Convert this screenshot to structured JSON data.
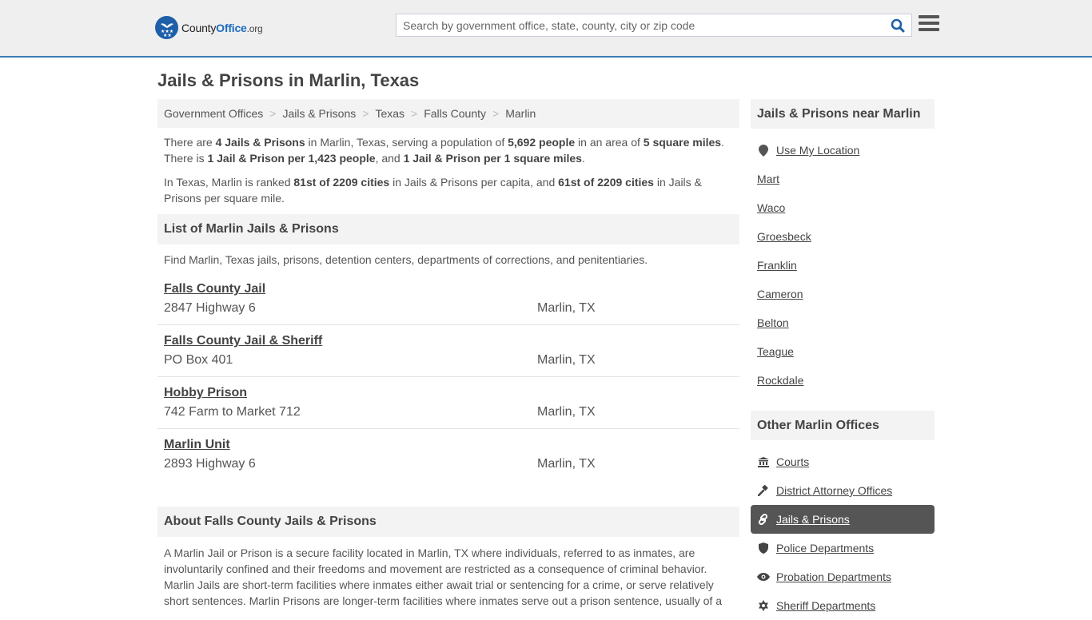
{
  "header": {
    "logo_name": "County",
    "logo_accent": "Office",
    "logo_tld": ".org",
    "search_placeholder": "Search by government office, state, county, city or zip code",
    "search_value": ""
  },
  "page_title": "Jails & Prisons in Marlin, Texas",
  "breadcrumb": [
    {
      "label": "Government Offices"
    },
    {
      "label": "Jails & Prisons"
    },
    {
      "label": "Texas"
    },
    {
      "label": "Falls County"
    },
    {
      "label": "Marlin"
    }
  ],
  "intro": {
    "p1": {
      "t1": "There are ",
      "b1": "4 Jails & Prisons",
      "t2": " in Marlin, Texas, serving a population of ",
      "b2": "5,692 people",
      "t3": " in an area of ",
      "b3": "5 square miles",
      "t4": ". There is ",
      "b4": "1 Jail & Prison per 1,423 people",
      "t5": ", and ",
      "b5": "1 Jail & Prison per 1 square miles",
      "t6": "."
    },
    "p2": {
      "t1": "In Texas, Marlin is ranked ",
      "b1": "81st of 2209 cities",
      "t2": " in Jails & Prisons per capita, and ",
      "b2": "61st of 2209 cities",
      "t3": " in Jails & Prisons per square mile."
    }
  },
  "list_section": {
    "title": "List of Marlin Jails & Prisons",
    "description": "Find Marlin, Texas jails, prisons, detention centers, departments of corrections, and penitentiaries.",
    "listings": [
      {
        "name": "Falls County Jail",
        "address": "2847 Highway 6",
        "city": "Marlin, TX"
      },
      {
        "name": "Falls County Jail & Sheriff",
        "address": "PO Box 401",
        "city": "Marlin, TX"
      },
      {
        "name": "Hobby Prison",
        "address": "742 Farm to Market 712",
        "city": "Marlin, TX"
      },
      {
        "name": "Marlin Unit",
        "address": "2893 Highway 6",
        "city": "Marlin, TX"
      }
    ]
  },
  "about_section": {
    "title": "About Falls County Jails & Prisons",
    "text": "A Marlin Jail or Prison is a secure facility located in Marlin, TX where individuals, referred to as inmates, are involuntarily confined and their freedoms and movement are restricted as a consequence of criminal behavior. Marlin Jails are short-term facilities where inmates either await trial or sentencing for a crime, or serve relatively short sentences. Marlin Prisons are longer-term facilities where inmates serve out a prison sentence, usually of a"
  },
  "sidebar": {
    "nearby_title": "Jails & Prisons near Marlin",
    "use_location": "Use My Location",
    "nearby": [
      "Mart",
      "Waco",
      "Groesbeck",
      "Franklin",
      "Cameron",
      "Belton",
      "Teague",
      "Rockdale"
    ],
    "other_title": "Other Marlin Offices",
    "other": [
      {
        "label": "Courts",
        "icon": "courthouse-icon"
      },
      {
        "label": "District Attorney Offices",
        "icon": "gavel-icon"
      },
      {
        "label": "Jails & Prisons",
        "icon": "link-icon",
        "active": true
      },
      {
        "label": "Police Departments",
        "icon": "shield-icon"
      },
      {
        "label": "Probation Departments",
        "icon": "eye-icon"
      },
      {
        "label": "Sheriff Departments",
        "icon": "star-badge-icon"
      }
    ]
  },
  "colors": {
    "brand_blue": "#1d5fa8",
    "header_border": "#3a7bb5",
    "active_item_bg": "#555555"
  }
}
